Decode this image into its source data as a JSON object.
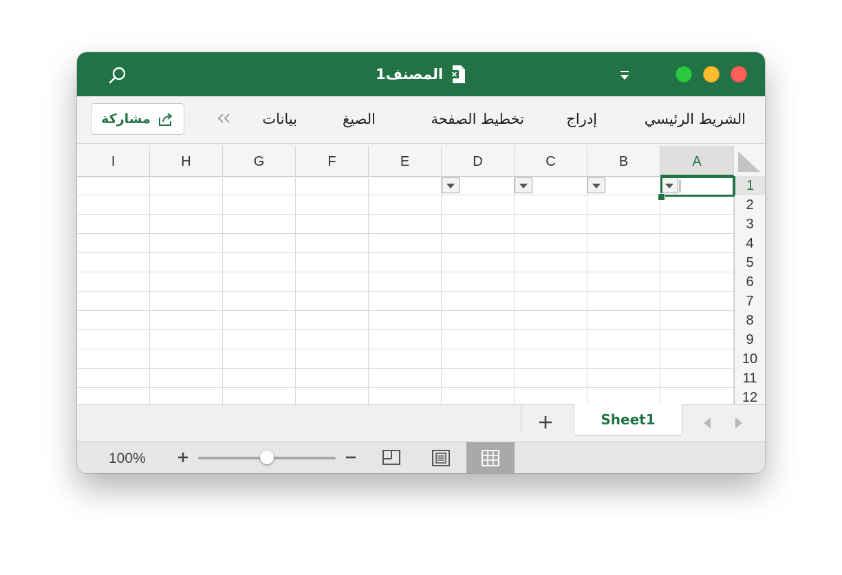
{
  "window": {
    "title": "المصنف1"
  },
  "ribbon": {
    "tabs": [
      "الشريط الرئيسي",
      "إدراج",
      "تخطيط الصفحة",
      "الصيغ",
      "بيانات"
    ],
    "share_label": "مشاركة"
  },
  "grid": {
    "columns": [
      "I",
      "H",
      "G",
      "F",
      "E",
      "D",
      "C",
      "B",
      "A"
    ],
    "active_column": "A",
    "rows": [
      "1",
      "2",
      "3",
      "4",
      "5",
      "6",
      "7",
      "8",
      "9",
      "10",
      "11",
      "12"
    ],
    "active_row": "1",
    "filter_columns": [
      "D",
      "C",
      "B",
      "A"
    ]
  },
  "sheets": {
    "tabs": [
      "Sheet1"
    ],
    "active": "Sheet1"
  },
  "status": {
    "zoom": "100%",
    "zoom_level": 0.5,
    "active_view": "normal"
  },
  "colors": {
    "accent": "#217346",
    "title_bar": "#217346"
  },
  "icons": {
    "search": "search-icon",
    "file": "excel-file-icon",
    "quick_access": "chevron-down-icon",
    "share": "share-icon",
    "overflow": "double-chevron-icon",
    "add_sheet": "plus-icon",
    "nav_prev": "triangle-left-icon",
    "nav_next": "triangle-right-icon",
    "zoom_in": "plus-icon",
    "zoom_out": "minus-icon",
    "views": [
      "page-break-view-icon",
      "page-layout-view-icon",
      "normal-view-icon"
    ]
  }
}
